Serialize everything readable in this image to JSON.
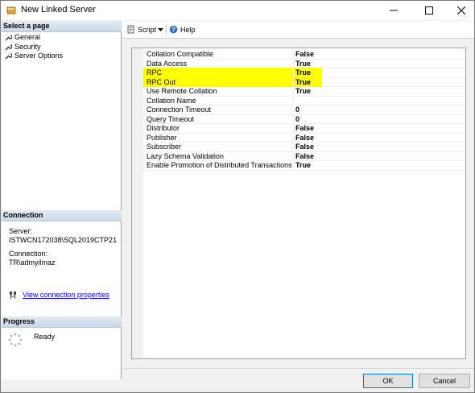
{
  "window": {
    "title": "New Linked Server"
  },
  "left": {
    "select_page_header": "Select a page",
    "pages": [
      {
        "label": "General"
      },
      {
        "label": "Security"
      },
      {
        "label": "Server Options"
      }
    ],
    "connection_header": "Connection",
    "server_label": "Server:",
    "server_value": "ISTWCN172038\\SQL2019CTP21",
    "connection_label": "Connection:",
    "connection_value": "TR\\admyilmaz",
    "view_connection_link": "View connection properties",
    "progress_header": "Progress",
    "progress_status": "Ready"
  },
  "toolbar": {
    "script_label": "Script",
    "help_label": "Help"
  },
  "options": [
    {
      "name": "Collation Compatible",
      "value": "False"
    },
    {
      "name": "Data Access",
      "value": "True"
    },
    {
      "name": "RPC",
      "value": "True",
      "highlighted": true
    },
    {
      "name": "RPC Out",
      "value": "True",
      "highlighted": true
    },
    {
      "name": "Use Remote Collation",
      "value": "True"
    },
    {
      "name": "Collation Name",
      "value": ""
    },
    {
      "name": "Connection Timeout",
      "value": "0"
    },
    {
      "name": "Query Timeout",
      "value": "0"
    },
    {
      "name": "Distributor",
      "value": "False"
    },
    {
      "name": "Publisher",
      "value": "False"
    },
    {
      "name": "Subscriber",
      "value": "False"
    },
    {
      "name": "Lazy Schema Validation",
      "value": "False"
    },
    {
      "name": "Enable Promotion of Distributed Transactions",
      "value": "True"
    }
  ],
  "highlight_color": "#ffff00",
  "link_color": "#0000ee",
  "buttons": {
    "ok_label": "OK",
    "cancel_label": "Cancel"
  }
}
